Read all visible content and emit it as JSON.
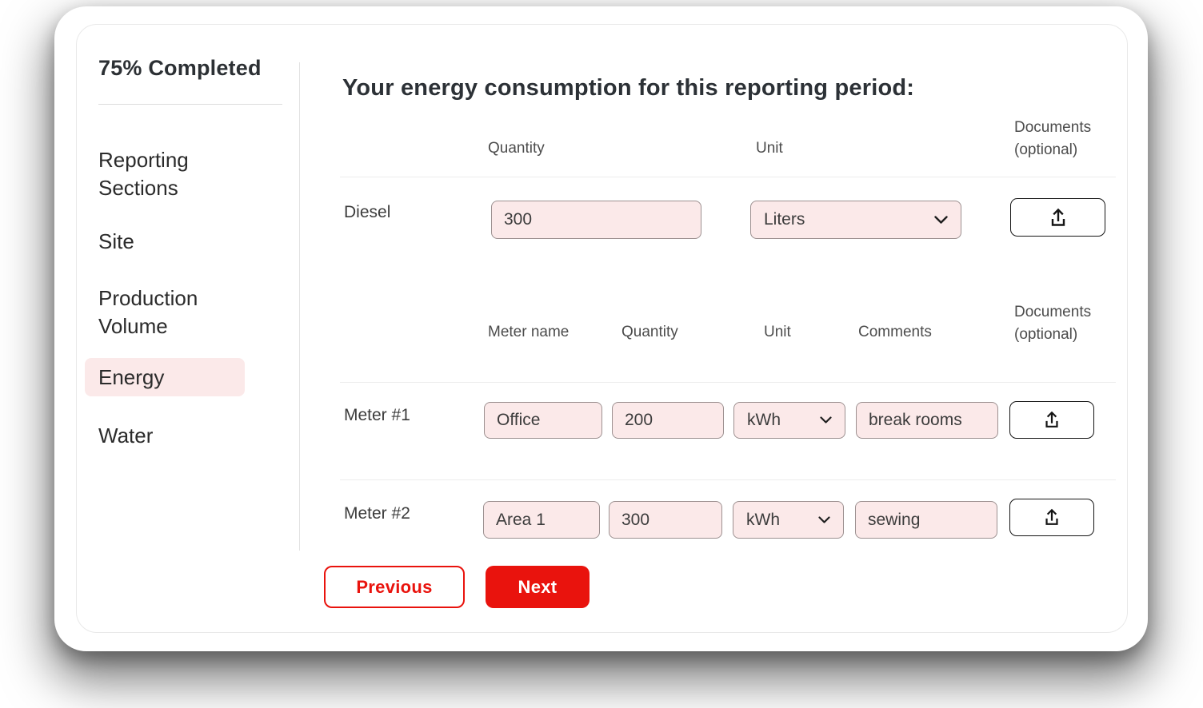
{
  "sidebar": {
    "progress_label": "75% Completed",
    "items": [
      {
        "label": "Reporting Sections",
        "active": false
      },
      {
        "label": "Site",
        "active": false
      },
      {
        "label": "Production Volume",
        "active": false
      },
      {
        "label": "Energy",
        "active": true
      },
      {
        "label": "Water",
        "active": false
      }
    ]
  },
  "main": {
    "title": "Your energy consumption for this reporting period:",
    "fuel_table": {
      "headers": {
        "quantity": "Quantity",
        "unit": "Unit",
        "documents": "Documents (optional)"
      },
      "rows": [
        {
          "label": "Diesel",
          "quantity": "300",
          "unit": "Liters"
        }
      ]
    },
    "meter_table": {
      "headers": {
        "meter_name": "Meter name",
        "quantity": "Quantity",
        "unit": "Unit",
        "comments": "Comments",
        "documents": "Documents (optional)"
      },
      "rows": [
        {
          "label": "Meter #1",
          "meter_name": "Office",
          "quantity": "200",
          "unit": "kWh",
          "comments": "break rooms"
        },
        {
          "label": "Meter #2",
          "meter_name": "Area 1",
          "quantity": "300",
          "unit": "kWh",
          "comments": "sewing"
        }
      ]
    },
    "buttons": {
      "previous": "Previous",
      "next": "Next"
    }
  },
  "icons": {
    "upload": "upload-icon",
    "chevron": "chevron-down-icon"
  },
  "colors": {
    "accent_red": "#e9130d",
    "input_pink": "#fbe9e9",
    "active_pill_pink": "#fbe9e9",
    "input_border": "#9c9090",
    "divider_gray": "#ededed",
    "text_dark": "#2c3136"
  }
}
